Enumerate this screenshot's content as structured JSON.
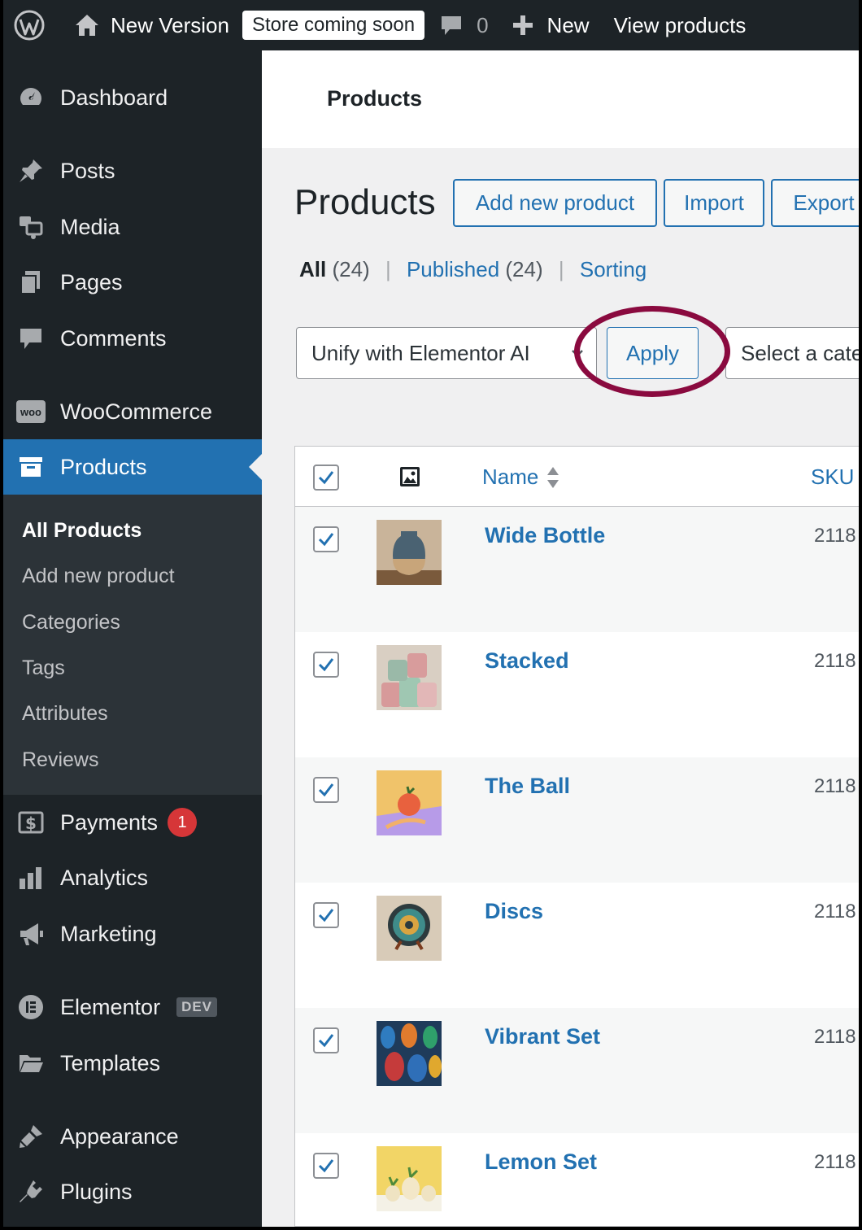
{
  "adminbar": {
    "site_name": "New Version",
    "store_badge": "Store coming soon",
    "comments_count": "0",
    "new_label": "New",
    "view_products": "View products"
  },
  "sidebar": {
    "items": [
      {
        "label": "Dashboard",
        "icon": "dashboard-icon"
      },
      {
        "label": "Posts",
        "icon": "pin-icon"
      },
      {
        "label": "Media",
        "icon": "media-icon"
      },
      {
        "label": "Pages",
        "icon": "pages-icon"
      },
      {
        "label": "Comments",
        "icon": "comment-icon"
      },
      {
        "label": "WooCommerce",
        "icon": "woo-icon",
        "icon_text": "woo"
      },
      {
        "label": "Products",
        "icon": "archive-icon"
      },
      {
        "label": "Payments",
        "icon": "dollar-icon",
        "badge": "1"
      },
      {
        "label": "Analytics",
        "icon": "bar-chart-icon"
      },
      {
        "label": "Marketing",
        "icon": "megaphone-icon"
      },
      {
        "label": "Elementor",
        "icon": "elementor-icon",
        "badge": "DEV"
      },
      {
        "label": "Templates",
        "icon": "folder-icon"
      },
      {
        "label": "Appearance",
        "icon": "brush-icon"
      },
      {
        "label": "Plugins",
        "icon": "plug-icon"
      }
    ],
    "submenu": [
      "All Products",
      "Add new product",
      "Categories",
      "Tags",
      "Attributes",
      "Reviews"
    ]
  },
  "header": {
    "title": "Products"
  },
  "main": {
    "heading": "Products",
    "buttons": {
      "add_new": "Add new product",
      "import": "Import",
      "export": "Export"
    },
    "filters": {
      "all": "All",
      "all_count": "(24)",
      "published": "Published",
      "published_count": "(24)",
      "sorting": "Sorting"
    },
    "bulk_action": "Unify with Elementor AI",
    "apply": "Apply",
    "category_placeholder": "Select a category"
  },
  "table": {
    "columns": {
      "name": "Name",
      "sku": "SKU"
    },
    "rows": [
      {
        "name": "Wide Bottle",
        "sku": "2118"
      },
      {
        "name": "Stacked",
        "sku": "2118"
      },
      {
        "name": "The Ball",
        "sku": "2118"
      },
      {
        "name": "Discs",
        "sku": "2118"
      },
      {
        "name": "Vibrant Set",
        "sku": "2118"
      },
      {
        "name": "Lemon Set",
        "sku": "2118"
      }
    ]
  },
  "colors": {
    "accent": "#2271b1",
    "sidebar": "#1d2327",
    "highlight": "#8a0a3f",
    "badge": "#d63638"
  }
}
